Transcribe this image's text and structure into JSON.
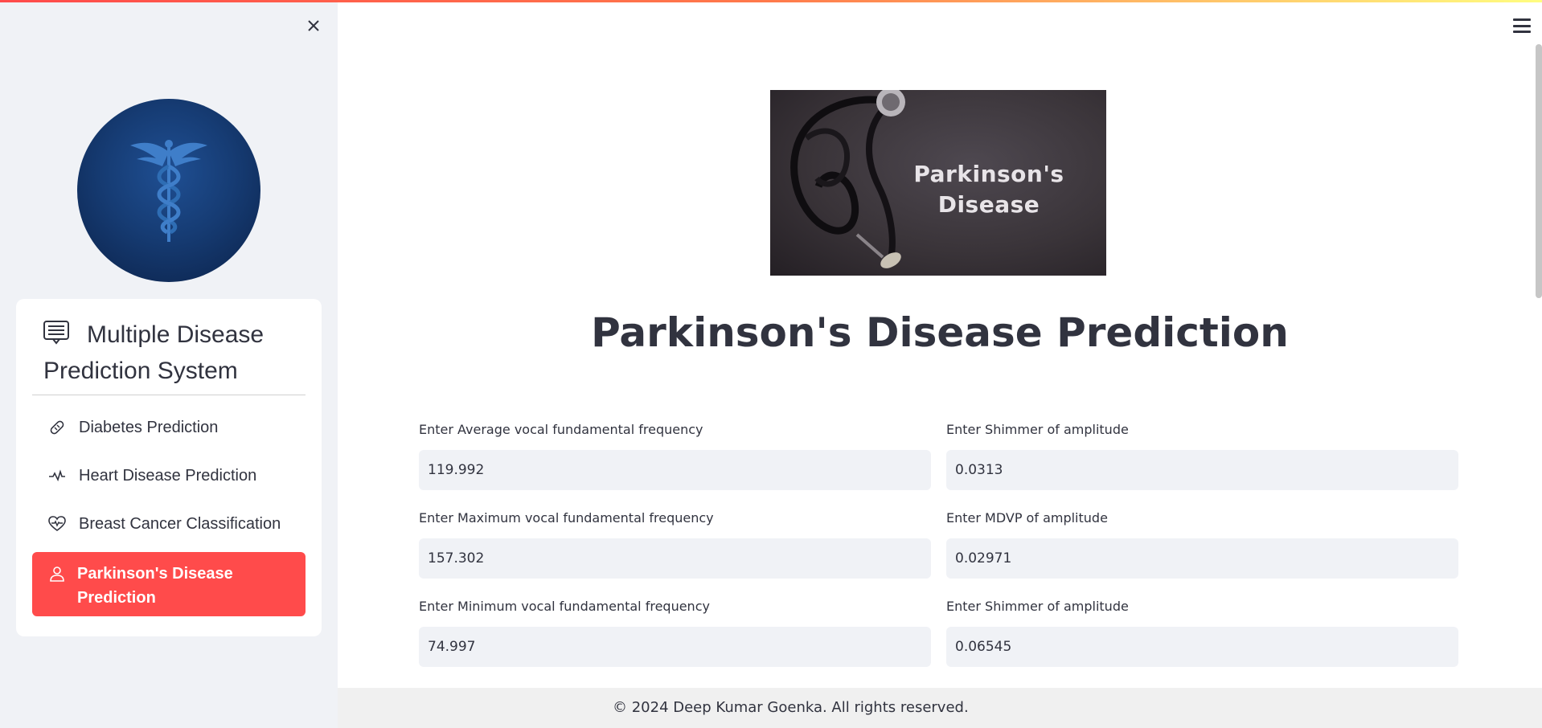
{
  "sidebar": {
    "title": "Multiple Disease Prediction System",
    "items": [
      {
        "label": "Diabetes Prediction",
        "icon": "bandaid-icon",
        "active": false
      },
      {
        "label": "Heart Disease Prediction",
        "icon": "activity-icon",
        "active": false
      },
      {
        "label": "Breast Cancer Classification",
        "icon": "heart-pulse-icon",
        "active": false
      },
      {
        "label": "Parkinson's Disease Prediction",
        "icon": "person-icon",
        "active": true
      }
    ],
    "active_color": "#ff4b4b"
  },
  "main": {
    "hero_image_text": "Parkinson's Disease",
    "page_title": "Parkinson's Disease Prediction",
    "fields_left": [
      {
        "label": "Enter Average vocal fundamental frequency",
        "value": "119.992"
      },
      {
        "label": "Enter Maximum vocal fundamental frequency",
        "value": "157.302"
      },
      {
        "label": "Enter Minimum vocal fundamental frequency",
        "value": "74.997"
      }
    ],
    "fields_right": [
      {
        "label": "Enter Shimmer of amplitude",
        "value": "0.0313"
      },
      {
        "label": "Enter MDVP of amplitude",
        "value": "0.02971"
      },
      {
        "label": "Enter Shimmer of amplitude",
        "value": "0.06545"
      }
    ]
  },
  "footer": {
    "text": "© 2024 Deep Kumar Goenka. All rights reserved."
  }
}
